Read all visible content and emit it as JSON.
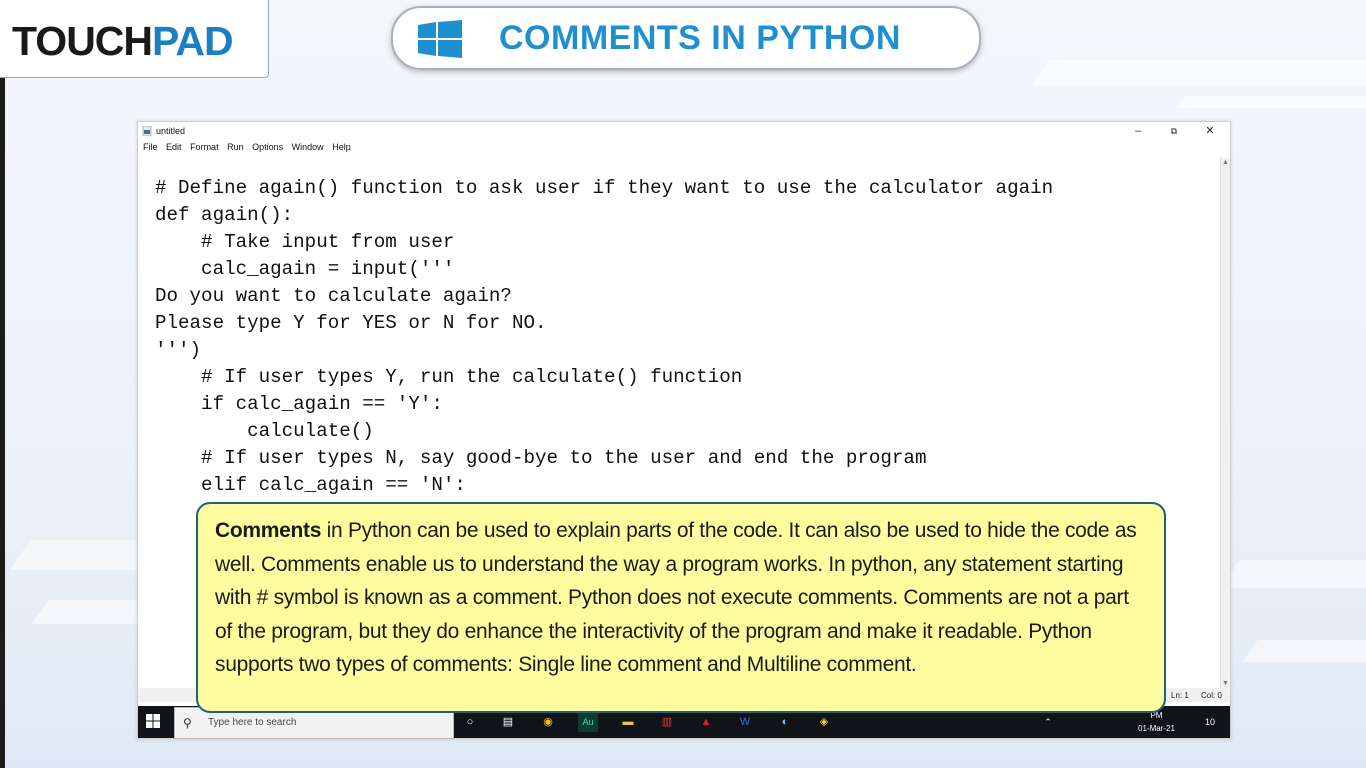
{
  "logo": {
    "part1": "TOUCH",
    "part2": "PAD"
  },
  "header": {
    "title": "COMMENTS IN PYTHON"
  },
  "window": {
    "title": "untitled",
    "controls": {
      "minimize": "–",
      "restore": "⧉",
      "close": "✕"
    },
    "menu": [
      "File",
      "Edit",
      "Format",
      "Run",
      "Options",
      "Window",
      "Help"
    ]
  },
  "code_lines": [
    "# Define again() function to ask user if they want to use the calculator again",
    "def again():",
    "    # Take input from user",
    "    calc_again = input('''",
    "Do you want to calculate again?",
    "Please type Y for YES or N for NO.",
    "''')",
    "    # If user types Y, run the calculate() function",
    "    if calc_again == 'Y':",
    "        calculate()",
    "    # If user types N, say good-bye to the user and end the program",
    "    elif calc_again == 'N':"
  ],
  "status": {
    "ln": "Ln: 1",
    "col": "Col: 0"
  },
  "taskbar": {
    "search_placeholder": "Type here to search",
    "time": "PM",
    "date": "01-Mar-21",
    "notification_count": "10"
  },
  "callout": {
    "bold": "Comments",
    "text": " in Python can be used to explain parts of the code. It can also be used to hide the code as well. Comments enable us to understand the way a program works. In python, any statement starting with # symbol is known as a comment. Python does not execute comments. Comments are not a part of the program, but they do enhance the interactivity of the program and make it readable. Python supports two types of comments: Single line comment and Multiline comment."
  }
}
